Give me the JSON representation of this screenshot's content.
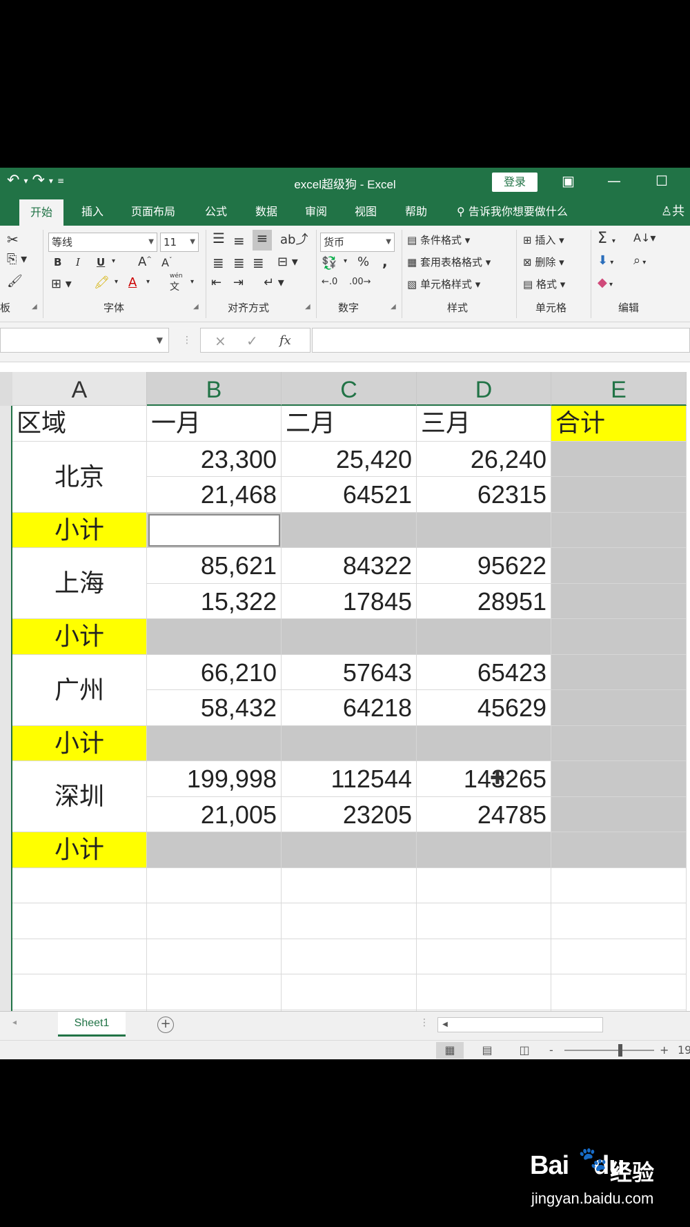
{
  "window": {
    "title": "excel超级狗  -  Excel",
    "login_label": "登录",
    "qat_undo": "↶",
    "qat_redo": "↷",
    "qat_more": "▾"
  },
  "tabs": [
    {
      "label": "开始",
      "active": true
    },
    {
      "label": "插入"
    },
    {
      "label": "页面布局"
    },
    {
      "label": "公式"
    },
    {
      "label": "数据"
    },
    {
      "label": "审阅"
    },
    {
      "label": "视图"
    },
    {
      "label": "帮助"
    }
  ],
  "tell_me": "告诉我你想要做什么",
  "share": "共",
  "ribbon": {
    "clipboard_label": "板",
    "font_name": "等线",
    "font_size": "11",
    "font_group_label": "字体",
    "align_group_label": "对齐方式",
    "number_format": "货币",
    "number_group_label": "数字",
    "percent": "%",
    "comma": ",",
    "styles": {
      "conditional": "条件格式",
      "table": "套用表格格式",
      "cell_styles": "单元格样式",
      "group_label": "样式"
    },
    "cells": {
      "insert": "插入",
      "delete": "删除",
      "format": "格式",
      "group_label": "单元格"
    },
    "editing_label": "编辑",
    "bold": "B",
    "italic": "I",
    "underline": "U",
    "grow_font": "A",
    "shrink_font": "A",
    "wen": "wén",
    "wen_char": "文"
  },
  "formula_bar": {
    "cancel": "×",
    "enter": "✓",
    "fx": "fx",
    "value": ""
  },
  "columns": [
    "A",
    "B",
    "C",
    "D",
    "E"
  ],
  "header_row": [
    "区域",
    "一月",
    "二月",
    "三月",
    "合计"
  ],
  "regions": [
    {
      "name": "北京",
      "rows": [
        [
          "23,300",
          "25,420",
          "26,240"
        ],
        [
          "21,468",
          "64521",
          "62315"
        ]
      ]
    },
    {
      "name": "上海",
      "rows": [
        [
          "85,621",
          "84322",
          "95622"
        ],
        [
          "15,322",
          "17845",
          "28951"
        ]
      ]
    },
    {
      "name": "广州",
      "rows": [
        [
          "66,210",
          "57643",
          "65423"
        ],
        [
          "58,432",
          "64218",
          "45629"
        ]
      ]
    },
    {
      "name": "深圳",
      "rows": [
        [
          "199,998",
          "112544",
          "143265"
        ],
        [
          "21,005",
          "23205",
          "24785"
        ]
      ]
    }
  ],
  "subtotal_label": "小计",
  "sheet_tab": "Sheet1",
  "add_sheet": "+",
  "zoom": {
    "minus": "-",
    "plus": "+",
    "value": "19"
  },
  "watermark": {
    "logo": "Bai",
    "logo2": "du",
    "cn": "经验",
    "url": "jingyan.baidu.com"
  },
  "colors": {
    "excel_green": "#217346",
    "subtotal_yellow": "#ffff00",
    "selection_gray": "#c8c8c8"
  }
}
